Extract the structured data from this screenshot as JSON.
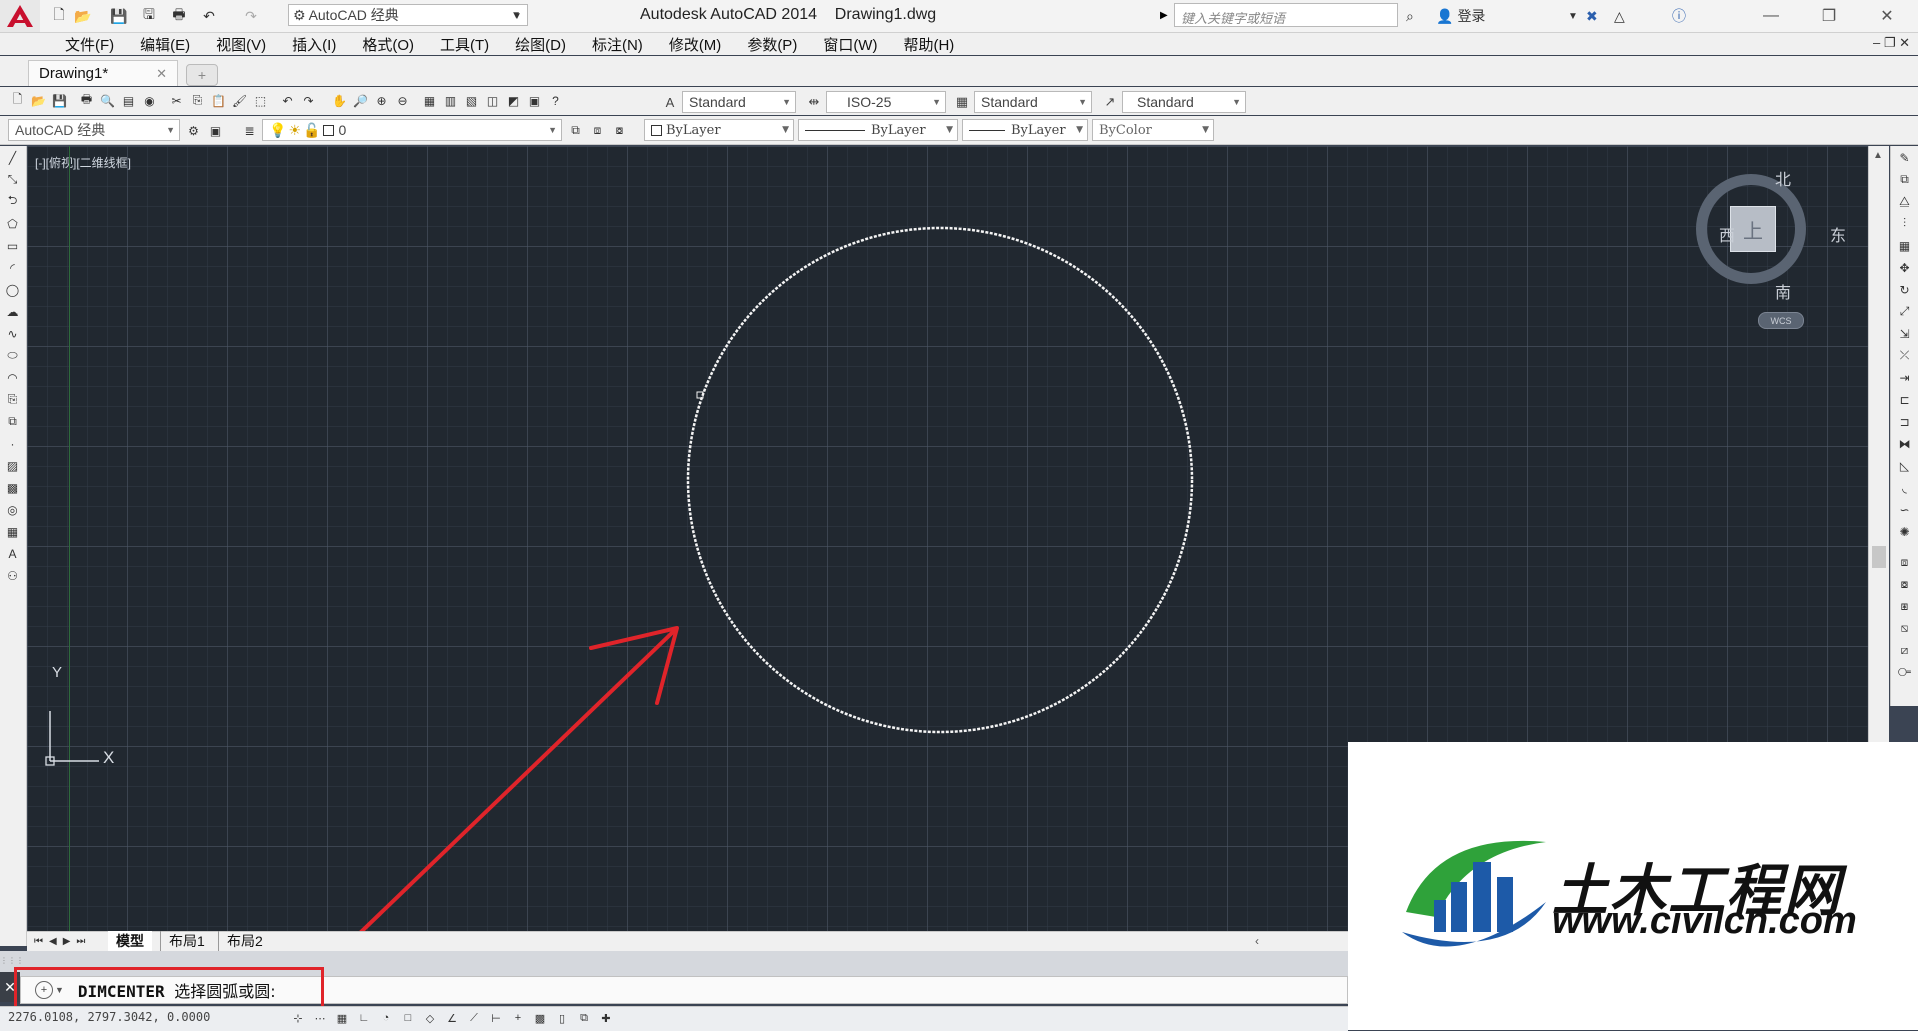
{
  "titlebar": {
    "title": "Autodesk AutoCAD 2014    Drawing1.dwg",
    "workspace": "AutoCAD 经典",
    "search_placeholder": "键入关键字或短语",
    "login": "登录"
  },
  "menu": [
    "文件(F)",
    "编辑(E)",
    "视图(V)",
    "插入(I)",
    "格式(O)",
    "工具(T)",
    "绘图(D)",
    "标注(N)",
    "修改(M)",
    "参数(P)",
    "窗口(W)",
    "帮助(H)"
  ],
  "file_tab": {
    "label": "Drawing1*"
  },
  "toolbar1": {
    "text_style": "Standard",
    "dim_style": "ISO-25",
    "table_style": "Standard",
    "multileader_style": "Standard"
  },
  "toolbar2": {
    "workspace": "AutoCAD 经典",
    "layer": "0",
    "color": "ByLayer",
    "linetype": "ByLayer",
    "lineweight": "ByLayer",
    "plot_style": "ByColor"
  },
  "viewport": {
    "label": "[-][俯视][二维线框]"
  },
  "viewcube": {
    "north": "北",
    "south": "南",
    "east": "东",
    "west": "西",
    "top": "上",
    "wcs": "WCS"
  },
  "ucs": {
    "x": "X",
    "y": "Y"
  },
  "layout_tabs": [
    "模型",
    "布局1",
    "布局2"
  ],
  "command": {
    "name": "DIMCENTER",
    "prompt": "选择圆弧或圆:"
  },
  "status": {
    "coords": "2276.0108, 2797.3042, 0.0000"
  },
  "watermark": {
    "title": "土木工程网",
    "url": "www.civilcn.com"
  },
  "colors": {
    "canvas": "#212830",
    "annotation_red": "#e0242a",
    "circle": "#f0f0f0"
  }
}
